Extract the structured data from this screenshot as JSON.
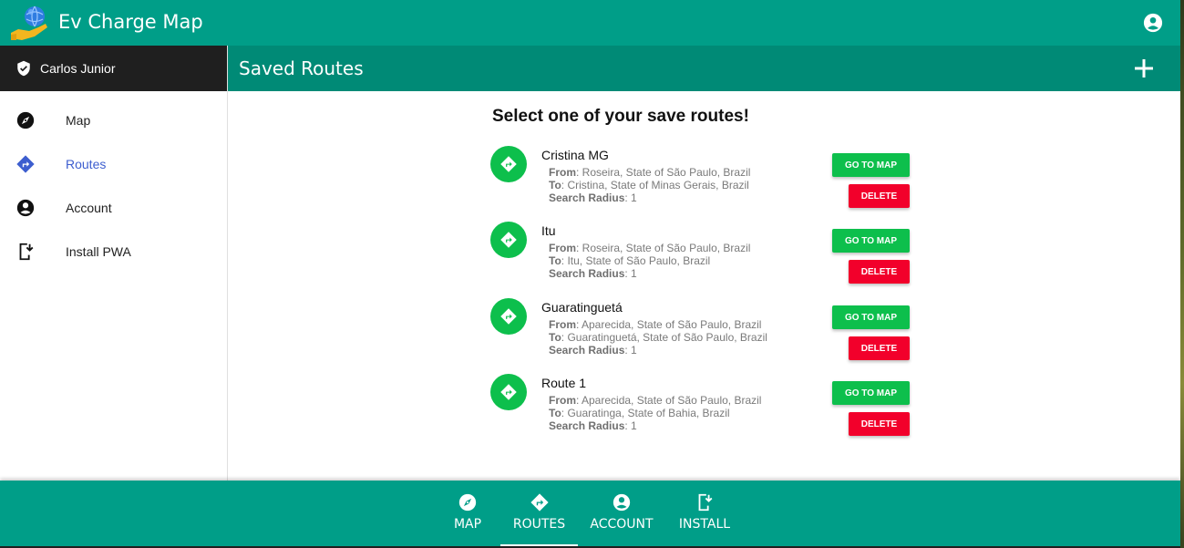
{
  "app": {
    "title": "Ev Charge Map"
  },
  "colors": {
    "primary": "#009e88",
    "header": "#008a76",
    "sidebar_user_bg": "#1f1f1f",
    "accent_green": "#0dbf4c",
    "danger_red": "#f2002b",
    "active_nav": "#3d5ecf"
  },
  "user": {
    "name": "Carlos Junior",
    "icon": "verified-shield-icon"
  },
  "sidebar": {
    "items": [
      {
        "label": "Map",
        "icon": "compass-icon",
        "active": false
      },
      {
        "label": "Routes",
        "icon": "directions-icon",
        "active": true
      },
      {
        "label": "Account",
        "icon": "account-circle-icon",
        "active": false
      },
      {
        "label": "Install PWA",
        "icon": "install-mobile-icon",
        "active": false
      }
    ]
  },
  "header": {
    "title": "Saved Routes",
    "add_icon": "plus-icon"
  },
  "main": {
    "heading": "Select one of your save routes!",
    "labels": {
      "from": "From",
      "to": "To",
      "radius": "Search Radius"
    },
    "go_label": "GO TO MAP",
    "delete_label": "DELETE",
    "routes": [
      {
        "name": "Cristina MG",
        "from": ": Roseira, State of São Paulo, Brazil",
        "to": ": Cristina, State of Minas Gerais, Brazil",
        "radius": ": 1"
      },
      {
        "name": "Itu",
        "from": ": Roseira, State of São Paulo, Brazil",
        "to": ": Itu, State of São Paulo, Brazil",
        "radius": ": 1"
      },
      {
        "name": "Guaratinguetá",
        "from": ": Aparecida, State of São Paulo, Brazil",
        "to": ": Guaratinguetá, State of São Paulo, Brazil",
        "radius": ": 1"
      },
      {
        "name": "Route 1",
        "from": ": Aparecida, State of São Paulo, Brazil",
        "to": ": Guaratinga, State of Bahia, Brazil",
        "radius": ": 1"
      }
    ]
  },
  "bottom_nav": {
    "items": [
      {
        "label": "MAP",
        "icon": "compass-icon",
        "active": false
      },
      {
        "label": "ROUTES",
        "icon": "directions-icon",
        "active": true
      },
      {
        "label": "ACCOUNT",
        "icon": "account-circle-icon",
        "active": false
      },
      {
        "label": "INSTALL",
        "icon": "install-mobile-icon",
        "active": false
      }
    ]
  }
}
